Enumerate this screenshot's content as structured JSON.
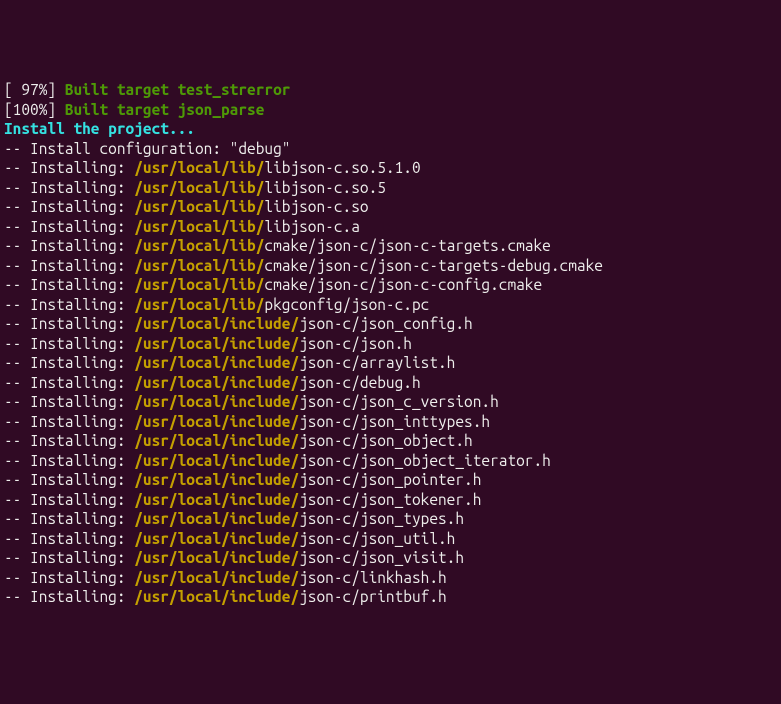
{
  "terminal": {
    "lines": [
      {
        "segments": [
          {
            "cls": "white",
            "text": "[ 97%] "
          },
          {
            "cls": "green-bold",
            "text": "Built target test_strerror"
          }
        ]
      },
      {
        "segments": [
          {
            "cls": "white",
            "text": "[100%] "
          },
          {
            "cls": "green-bold",
            "text": "Built target json_parse"
          }
        ]
      },
      {
        "segments": [
          {
            "cls": "cyan-bold",
            "text": "Install the project..."
          }
        ]
      },
      {
        "segments": [
          {
            "cls": "white",
            "text": "-- Install configuration: \"debug\""
          }
        ]
      },
      {
        "segments": [
          {
            "cls": "white",
            "text": "-- Installing: "
          },
          {
            "cls": "orange-bold",
            "text": "/usr/local/lib/"
          },
          {
            "cls": "white",
            "text": "libjson-c.so.5.1.0"
          }
        ]
      },
      {
        "segments": [
          {
            "cls": "white",
            "text": "-- Installing: "
          },
          {
            "cls": "orange-bold",
            "text": "/usr/local/lib/"
          },
          {
            "cls": "white",
            "text": "libjson-c.so.5"
          }
        ]
      },
      {
        "segments": [
          {
            "cls": "white",
            "text": "-- Installing: "
          },
          {
            "cls": "orange-bold",
            "text": "/usr/local/lib/"
          },
          {
            "cls": "white",
            "text": "libjson-c.so"
          }
        ]
      },
      {
        "segments": [
          {
            "cls": "white",
            "text": "-- Installing: "
          },
          {
            "cls": "orange-bold",
            "text": "/usr/local/lib/"
          },
          {
            "cls": "white",
            "text": "libjson-c.a"
          }
        ]
      },
      {
        "segments": [
          {
            "cls": "white",
            "text": "-- Installing: "
          },
          {
            "cls": "orange-bold",
            "text": "/usr/local/lib/"
          },
          {
            "cls": "white",
            "text": "cmake/json-c/json-c-targets.cmake"
          }
        ]
      },
      {
        "segments": [
          {
            "cls": "white",
            "text": "-- Installing: "
          },
          {
            "cls": "orange-bold",
            "text": "/usr/local/lib/"
          },
          {
            "cls": "white",
            "text": "cmake/json-c/json-c-targets-debug.cmake"
          }
        ]
      },
      {
        "segments": [
          {
            "cls": "white",
            "text": "-- Installing: "
          },
          {
            "cls": "orange-bold",
            "text": "/usr/local/lib/"
          },
          {
            "cls": "white",
            "text": "cmake/json-c/json-c-config.cmake"
          }
        ]
      },
      {
        "segments": [
          {
            "cls": "white",
            "text": "-- Installing: "
          },
          {
            "cls": "orange-bold",
            "text": "/usr/local/lib/"
          },
          {
            "cls": "white",
            "text": "pkgconfig/json-c.pc"
          }
        ]
      },
      {
        "segments": [
          {
            "cls": "white",
            "text": "-- Installing: "
          },
          {
            "cls": "orange-bold",
            "text": "/usr/local/include/"
          },
          {
            "cls": "white",
            "text": "json-c/json_config.h"
          }
        ]
      },
      {
        "segments": [
          {
            "cls": "white",
            "text": "-- Installing: "
          },
          {
            "cls": "orange-bold",
            "text": "/usr/local/include/"
          },
          {
            "cls": "white",
            "text": "json-c/json.h"
          }
        ]
      },
      {
        "segments": [
          {
            "cls": "white",
            "text": "-- Installing: "
          },
          {
            "cls": "orange-bold",
            "text": "/usr/local/include/"
          },
          {
            "cls": "white",
            "text": "json-c/arraylist.h"
          }
        ]
      },
      {
        "segments": [
          {
            "cls": "white",
            "text": "-- Installing: "
          },
          {
            "cls": "orange-bold",
            "text": "/usr/local/include/"
          },
          {
            "cls": "white",
            "text": "json-c/debug.h"
          }
        ]
      },
      {
        "segments": [
          {
            "cls": "white",
            "text": "-- Installing: "
          },
          {
            "cls": "orange-bold",
            "text": "/usr/local/include/"
          },
          {
            "cls": "white",
            "text": "json-c/json_c_version.h"
          }
        ]
      },
      {
        "segments": [
          {
            "cls": "white",
            "text": "-- Installing: "
          },
          {
            "cls": "orange-bold",
            "text": "/usr/local/include/"
          },
          {
            "cls": "white",
            "text": "json-c/json_inttypes.h"
          }
        ]
      },
      {
        "segments": [
          {
            "cls": "white",
            "text": "-- Installing: "
          },
          {
            "cls": "orange-bold",
            "text": "/usr/local/include/"
          },
          {
            "cls": "white",
            "text": "json-c/json_object.h"
          }
        ]
      },
      {
        "segments": [
          {
            "cls": "white",
            "text": "-- Installing: "
          },
          {
            "cls": "orange-bold",
            "text": "/usr/local/include/"
          },
          {
            "cls": "white",
            "text": "json-c/json_object_iterator.h"
          }
        ]
      },
      {
        "segments": [
          {
            "cls": "white",
            "text": "-- Installing: "
          },
          {
            "cls": "orange-bold",
            "text": "/usr/local/include/"
          },
          {
            "cls": "white",
            "text": "json-c/json_pointer.h"
          }
        ]
      },
      {
        "segments": [
          {
            "cls": "white",
            "text": "-- Installing: "
          },
          {
            "cls": "orange-bold",
            "text": "/usr/local/include/"
          },
          {
            "cls": "white",
            "text": "json-c/json_tokener.h"
          }
        ]
      },
      {
        "segments": [
          {
            "cls": "white",
            "text": "-- Installing: "
          },
          {
            "cls": "orange-bold",
            "text": "/usr/local/include/"
          },
          {
            "cls": "white",
            "text": "json-c/json_types.h"
          }
        ]
      },
      {
        "segments": [
          {
            "cls": "white",
            "text": "-- Installing: "
          },
          {
            "cls": "orange-bold",
            "text": "/usr/local/include/"
          },
          {
            "cls": "white",
            "text": "json-c/json_util.h"
          }
        ]
      },
      {
        "segments": [
          {
            "cls": "white",
            "text": "-- Installing: "
          },
          {
            "cls": "orange-bold",
            "text": "/usr/local/include/"
          },
          {
            "cls": "white",
            "text": "json-c/json_visit.h"
          }
        ]
      },
      {
        "segments": [
          {
            "cls": "white",
            "text": "-- Installing: "
          },
          {
            "cls": "orange-bold",
            "text": "/usr/local/include/"
          },
          {
            "cls": "white",
            "text": "json-c/linkhash.h"
          }
        ]
      },
      {
        "segments": [
          {
            "cls": "white",
            "text": "-- Installing: "
          },
          {
            "cls": "orange-bold",
            "text": "/usr/local/include/"
          },
          {
            "cls": "white",
            "text": "json-c/printbuf.h"
          }
        ]
      }
    ]
  }
}
